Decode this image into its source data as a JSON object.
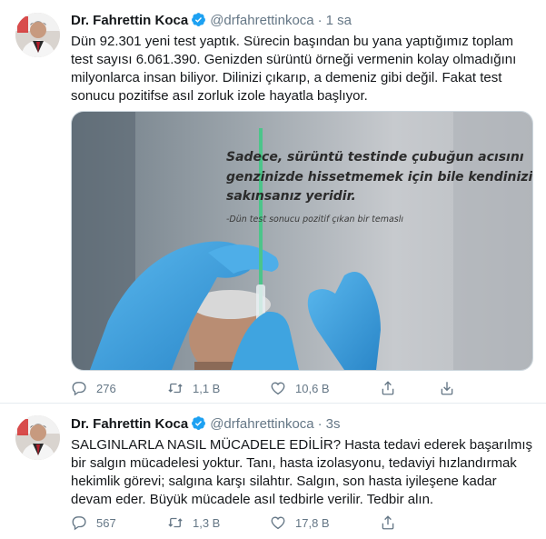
{
  "tweets": [
    {
      "author": "Dr. Fahrettin Koca",
      "handle": "@drfahrettinkoca",
      "separator": "·",
      "time": "1 sa",
      "text": "Dün 92.301 yeni test yaptık. Sürecin başından bu yana yaptığımız toplam test sayısı 6.061.390. Genizden sürüntü örneği vermenin kolay olmadığını milyonlarca insan biliyor. Dilinizi çıkarıp, a demeniz gibi değil. Fakat test sonucu pozitifse asıl zorluk izole hayatla başlıyor.",
      "media": {
        "quote_lines": [
          "Sadece, sürüntü testinde çubuğun acısını",
          "genzinizde hissetmemek için bile kendinizi",
          "sakınsanız yeridir."
        ],
        "attribution": "-Dün test sonucu pozitif çıkan bir temaslı"
      },
      "stats": {
        "replies": "276",
        "retweets": "1,1 B",
        "likes": "10,6 B"
      }
    },
    {
      "author": "Dr. Fahrettin Koca",
      "handle": "@drfahrettinkoca",
      "separator": "·",
      "time": "3s",
      "text": "SALGINLARLA NASIL MÜCADELE EDİLİR? Hasta tedavi ederek başarılmış bir salgın mücadelesi yoktur. Tanı, hasta izolasyonu, tedaviyi hızlandırmak hekimlik görevi; salgına karşı silahtır. Salgın, son hasta iyileşene kadar devam eder. Büyük mücadele asıl tedbirle verilir. Tedbir alın.",
      "stats": {
        "replies": "567",
        "retweets": "1,3 B",
        "likes": "17,8 B"
      }
    }
  ],
  "colors": {
    "verified": "#1da1f2",
    "muted": "#657786",
    "text": "#14171a",
    "glove": "#3fa4e0"
  },
  "icons": [
    "reply-icon",
    "retweet-icon",
    "like-icon",
    "share-icon",
    "verified-icon"
  ]
}
